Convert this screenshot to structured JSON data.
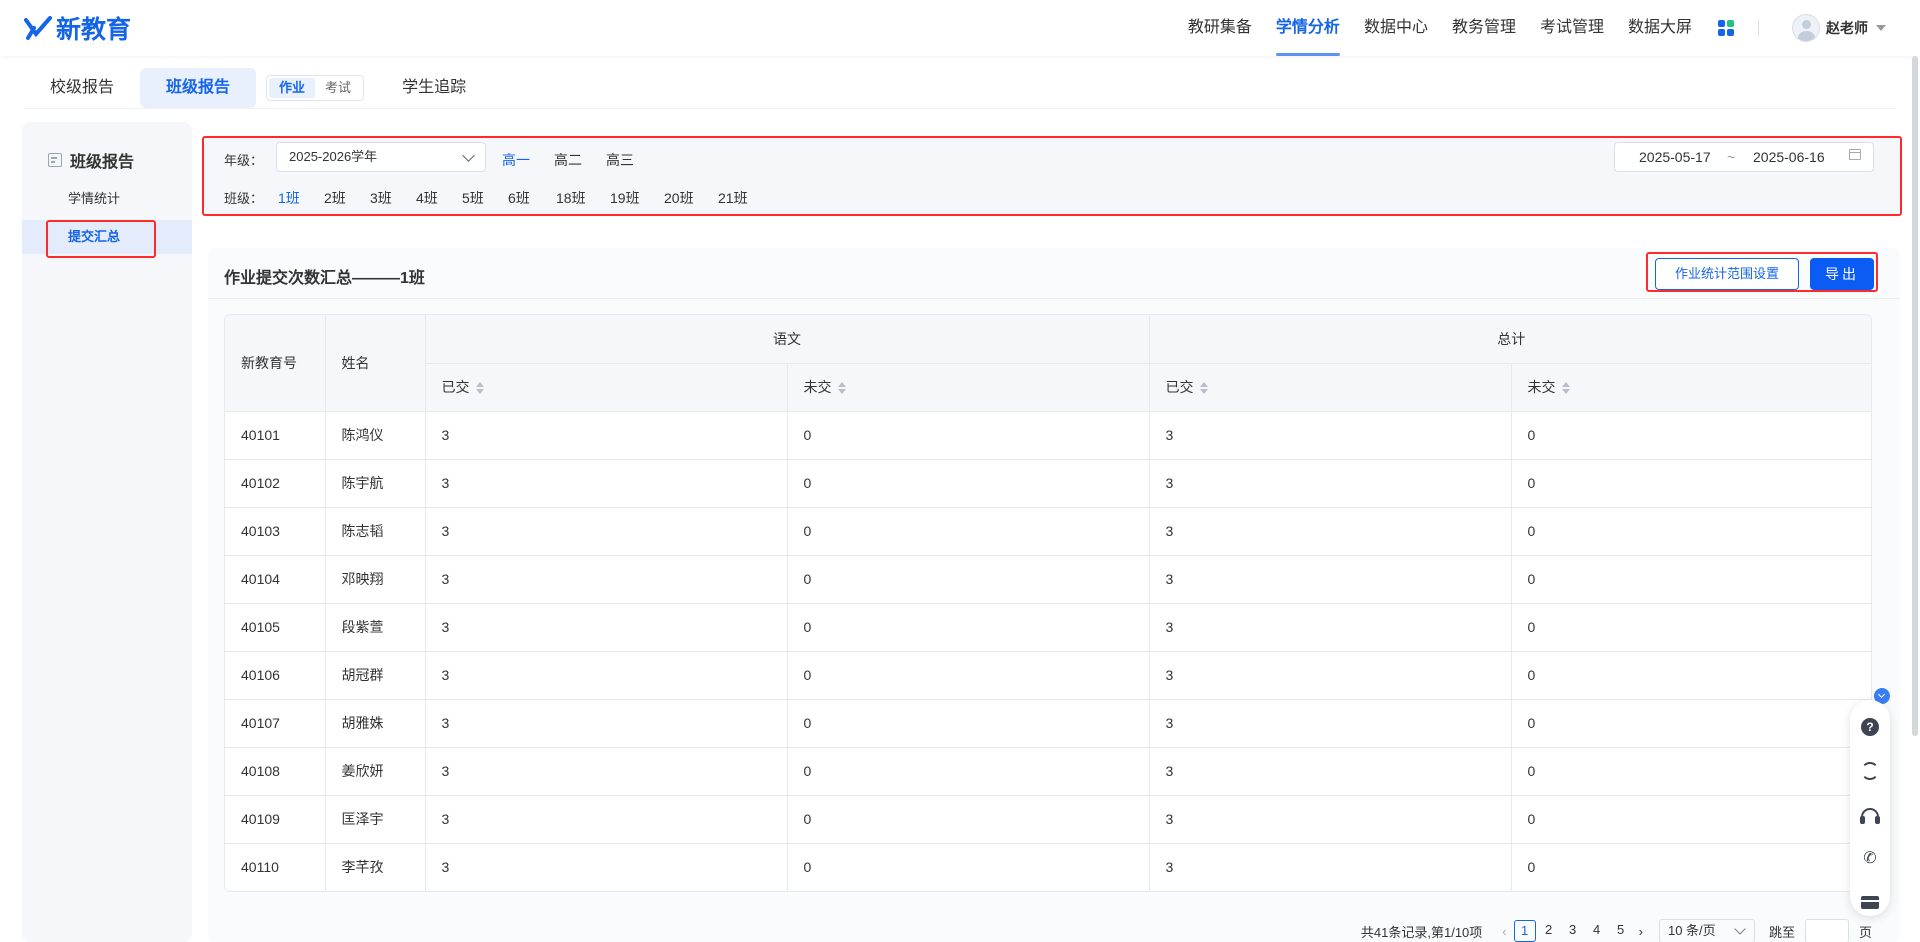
{
  "header": {
    "logo_text": "新教育",
    "nav": [
      {
        "label": "教研集备",
        "active": false
      },
      {
        "label": "学情分析",
        "active": true
      },
      {
        "label": "数据中心",
        "active": false
      },
      {
        "label": "教务管理",
        "active": false
      },
      {
        "label": "考试管理",
        "active": false
      },
      {
        "label": "数据大屏",
        "active": false
      }
    ],
    "user_name": "赵老师"
  },
  "tabs": {
    "items": [
      "校级报告",
      "班级报告",
      "学生追踪"
    ],
    "active": "班级报告",
    "toggle": [
      "作业",
      "考试"
    ],
    "toggle_active": "作业"
  },
  "sidebar": {
    "title": "班级报告",
    "items": [
      "学情统计",
      "提交汇总"
    ],
    "active": "提交汇总"
  },
  "filter": {
    "grade_label": "年级：",
    "year_value": "2025-2026学年",
    "grades": [
      "高一",
      "高二",
      "高三"
    ],
    "grade_active": "高一",
    "class_label": "班级：",
    "classes": [
      "1班",
      "2班",
      "3班",
      "4班",
      "5班",
      "6班",
      "18班",
      "19班",
      "20班",
      "21班"
    ],
    "class_active": "1班",
    "date_start": "2025-05-17",
    "date_sep": "~",
    "date_end": "2025-06-16"
  },
  "card": {
    "title": "作业提交次数汇总———1班",
    "range_button": "作业统计范围设置",
    "export_button": "导出"
  },
  "table": {
    "col_id": "新教育号",
    "col_name": "姓名",
    "group_subject": "语文",
    "group_total": "总计",
    "col_submitted": "已交",
    "col_unsubmitted": "未交",
    "rows": [
      {
        "id": "40101",
        "name": "陈鸿仪",
        "sub_done": "3",
        "sub_not": "0",
        "tot_done": "3",
        "tot_not": "0"
      },
      {
        "id": "40102",
        "name": "陈宇航",
        "sub_done": "3",
        "sub_not": "0",
        "tot_done": "3",
        "tot_not": "0"
      },
      {
        "id": "40103",
        "name": "陈志韬",
        "sub_done": "3",
        "sub_not": "0",
        "tot_done": "3",
        "tot_not": "0"
      },
      {
        "id": "40104",
        "name": "邓映翔",
        "sub_done": "3",
        "sub_not": "0",
        "tot_done": "3",
        "tot_not": "0"
      },
      {
        "id": "40105",
        "name": "段紫萱",
        "sub_done": "3",
        "sub_not": "0",
        "tot_done": "3",
        "tot_not": "0"
      },
      {
        "id": "40106",
        "name": "胡冠群",
        "sub_done": "3",
        "sub_not": "0",
        "tot_done": "3",
        "tot_not": "0"
      },
      {
        "id": "40107",
        "name": "胡雅姝",
        "sub_done": "3",
        "sub_not": "0",
        "tot_done": "3",
        "tot_not": "0"
      },
      {
        "id": "40108",
        "name": "姜欣妍",
        "sub_done": "3",
        "sub_not": "0",
        "tot_done": "3",
        "tot_not": "0"
      },
      {
        "id": "40109",
        "name": "匡泽宇",
        "sub_done": "3",
        "sub_not": "0",
        "tot_done": "3",
        "tot_not": "0"
      },
      {
        "id": "40110",
        "name": "李芊孜",
        "sub_done": "3",
        "sub_not": "0",
        "tot_done": "3",
        "tot_not": "0"
      }
    ]
  },
  "pager": {
    "total_text": "共41条记录,第1/10项",
    "pages": [
      "1",
      "2",
      "3",
      "4",
      "5"
    ],
    "current": "1",
    "page_size": "10 条/页",
    "jump_label": "跳至",
    "page_unit": "页"
  },
  "colors": {
    "accent": "#1565e8",
    "export_bg": "#0a5cf5",
    "annotation": "#ff2b2b"
  },
  "icons": {
    "float": [
      "help-icon",
      "refresh-icon",
      "headset-icon",
      "phone-icon",
      "card-icon"
    ]
  }
}
